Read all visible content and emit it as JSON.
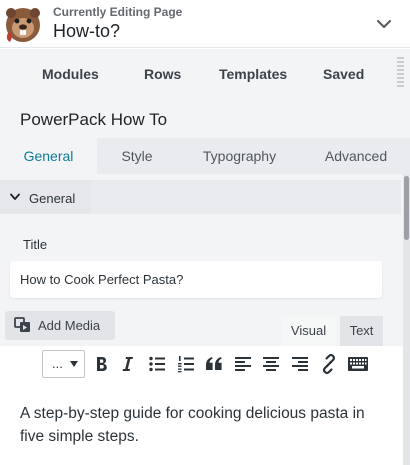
{
  "header": {
    "subtitle": "Currently Editing Page",
    "title": "How-to?",
    "avatar_icon": "beaver-mascot-icon",
    "toggle_icon": "chevron-down-icon"
  },
  "top_nav": {
    "items": [
      {
        "label": "Modules"
      },
      {
        "label": "Rows"
      },
      {
        "label": "Templates"
      },
      {
        "label": "Saved"
      }
    ],
    "handle_icon": "drag-handle-icon"
  },
  "panel": {
    "title": "PowerPack How To",
    "tabs": [
      {
        "label": "General",
        "active": true
      },
      {
        "label": "Style",
        "active": false
      },
      {
        "label": "Typography",
        "active": false
      },
      {
        "label": "Advanced",
        "active": false
      }
    ],
    "accent_color": "#0f7b96"
  },
  "section": {
    "label": "General",
    "expanded": true
  },
  "title_field": {
    "label": "Title",
    "value": "How to Cook Perfect Pasta?"
  },
  "editor": {
    "add_media_label": "Add Media",
    "modes": [
      {
        "label": "Visual",
        "active": true
      },
      {
        "label": "Text",
        "active": false
      }
    ],
    "format_value": "...",
    "toolbar_icons": [
      "bold-icon",
      "italic-icon",
      "bullet-list-icon",
      "numbered-list-icon",
      "blockquote-icon",
      "align-left-icon",
      "align-center-icon",
      "align-right-icon",
      "link-icon",
      "keyboard-icon"
    ],
    "content": "A step-by-step guide for cooking delicious pasta in five simple steps."
  }
}
